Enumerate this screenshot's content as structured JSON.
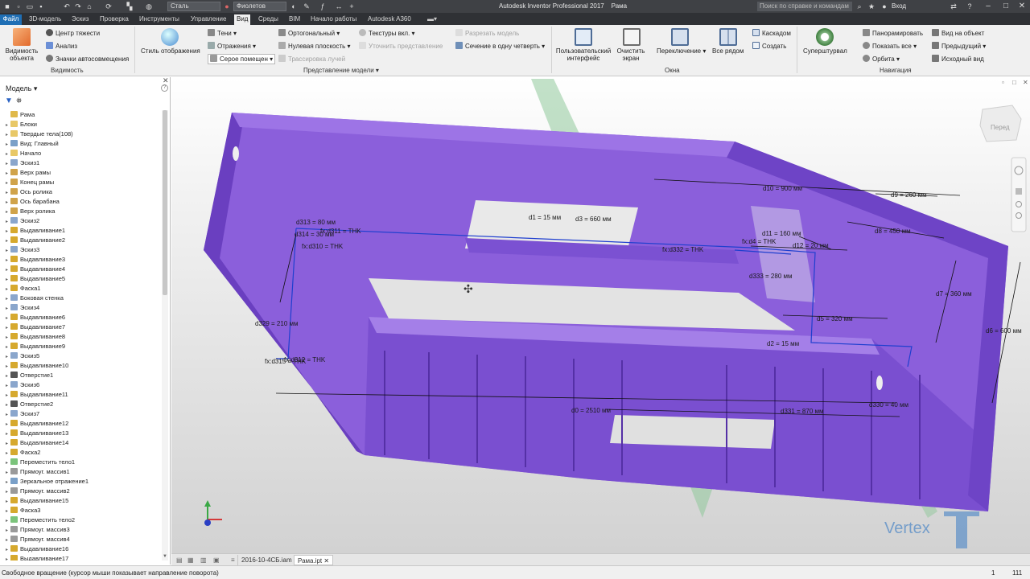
{
  "titlebar": {
    "material": "Сталь",
    "appearance": "Фиолетов",
    "app_title": "Autodesk Inventor Professional 2017",
    "document": "Рама",
    "help_search": "Поиск по справке и командам",
    "sign_in": "Вход"
  },
  "tabs": [
    "Файл",
    "3D-модель",
    "Эскиз",
    "Проверка",
    "Инструменты",
    "Управление",
    "Вид",
    "Среды",
    "BIM",
    "Начало работы",
    "Autodesk A360"
  ],
  "ribbon": {
    "visibility": {
      "object_visibility": "Видимость объекта",
      "center_gravity": "Центр тяжести",
      "analysis": "Анализ",
      "auto_offset_icons": "Значки автосовмещения",
      "label": "Видимость"
    },
    "appearance": {
      "display_style": "Стиль отображения",
      "shadows": "Тени",
      "reflections": "Отражения",
      "gray_room": "Серое помещен",
      "orthographic": "Ортогональный",
      "ground_plane": "Нулевая плоскость",
      "ray_tracing": "Трассировка лучей",
      "textures_on": "Текстуры вкл.",
      "refine_view": "Уточнить представление",
      "split_model": "Разрезать модель",
      "quarter_section": "Сечение в одну четверть",
      "label": "Представление модели"
    },
    "windows": {
      "user_interface": "Пользовательский интерфейс",
      "clean_screen": "Очистить экран",
      "switch": "Переключение",
      "tile": "Все рядом",
      "cascade": "Каскадом",
      "new": "Создать",
      "label": "Окна"
    },
    "navigation": {
      "steeringwheel": "Суперштурвал",
      "pan": "Панорамировать",
      "zoom_all": "Показать все",
      "orbit": "Орбита",
      "look_at": "Вид на объект",
      "previous": "Предыдущий",
      "home": "Исходный вид",
      "label": "Навигация"
    }
  },
  "browser": {
    "title": "Модель",
    "items": [
      {
        "label": "Рама",
        "icon": "part-icon"
      },
      {
        "label": "Блоки",
        "icon": "folder-icon"
      },
      {
        "label": "Твердые тела(108)",
        "icon": "folder-icon"
      },
      {
        "label": "Вид: Главный",
        "icon": "view-icon"
      },
      {
        "label": "Начало",
        "icon": "folder-icon"
      },
      {
        "label": "Эскиз1",
        "icon": "sketch-icon"
      },
      {
        "label": "Верх рамы",
        "icon": "plane-icon"
      },
      {
        "label": "Конец рамы",
        "icon": "plane-icon"
      },
      {
        "label": "Ось ролика",
        "icon": "plane-icon"
      },
      {
        "label": "Ось барабана",
        "icon": "plane-icon"
      },
      {
        "label": "Верх ролика",
        "icon": "plane-icon"
      },
      {
        "label": "Эскиз2",
        "icon": "sketch-icon"
      },
      {
        "label": "Выдавливание1",
        "icon": "extrude-icon"
      },
      {
        "label": "Выдавливание2",
        "icon": "extrude-icon"
      },
      {
        "label": "Эскиз3",
        "icon": "sketch-icon"
      },
      {
        "label": "Выдавливание3",
        "icon": "extrude-icon"
      },
      {
        "label": "Выдавливание4",
        "icon": "extrude-icon"
      },
      {
        "label": "Выдавливание5",
        "icon": "extrude-icon"
      },
      {
        "label": "Фаска1",
        "icon": "chamfer-icon"
      },
      {
        "label": "Боковая стенка",
        "icon": "sketch-icon"
      },
      {
        "label": "Эскиз4",
        "icon": "sketch-icon"
      },
      {
        "label": "Выдавливание6",
        "icon": "extrude-icon"
      },
      {
        "label": "Выдавливание7",
        "icon": "extrude-icon"
      },
      {
        "label": "Выдавливание8",
        "icon": "extrude-icon"
      },
      {
        "label": "Выдавливание9",
        "icon": "extrude-icon"
      },
      {
        "label": "Эскиз5",
        "icon": "sketch-icon"
      },
      {
        "label": "Выдавливание10",
        "icon": "extrude-icon"
      },
      {
        "label": "Отверстие1",
        "icon": "hole-icon"
      },
      {
        "label": "Эскиз6",
        "icon": "sketch-icon"
      },
      {
        "label": "Выдавливание11",
        "icon": "extrude-icon"
      },
      {
        "label": "Отверстие2",
        "icon": "hole-icon"
      },
      {
        "label": "Эскиз7",
        "icon": "sketch-icon"
      },
      {
        "label": "Выдавливание12",
        "icon": "extrude-icon"
      },
      {
        "label": "Выдавливание13",
        "icon": "extrude-icon"
      },
      {
        "label": "Выдавливание14",
        "icon": "extrude-icon"
      },
      {
        "label": "Фаска2",
        "icon": "chamfer-icon"
      },
      {
        "label": "Переместить тело1",
        "icon": "move-icon"
      },
      {
        "label": "Прямоуг. массив1",
        "icon": "pattern-icon"
      },
      {
        "label": "Зеркальное отражение1",
        "icon": "mirror-icon"
      },
      {
        "label": "Прямоуг. массив2",
        "icon": "pattern-icon"
      },
      {
        "label": "Выдавливание15",
        "icon": "extrude-icon"
      },
      {
        "label": "Фаска3",
        "icon": "chamfer-icon"
      },
      {
        "label": "Переместить тело2",
        "icon": "move-icon"
      },
      {
        "label": "Прямоуг. массив3",
        "icon": "pattern-icon"
      },
      {
        "label": "Прямоуг. массив4",
        "icon": "pattern-icon"
      },
      {
        "label": "Выдавливание16",
        "icon": "extrude-icon"
      },
      {
        "label": "Выдавливание17",
        "icon": "extrude-icon"
      }
    ]
  },
  "viewcube": {
    "face": "Перед"
  },
  "dimensions": [
    {
      "id": "d10",
      "text": "d10 = 900 мм"
    },
    {
      "id": "d9",
      "text": "d9 = 260 мм"
    },
    {
      "id": "d8",
      "text": "d8 = 450 мм"
    },
    {
      "id": "d11",
      "text": "d11 = 160 мм"
    },
    {
      "id": "d12",
      "text": "d12 = 20 мм"
    },
    {
      "id": "fxd4",
      "text": "fx:d4 = THK"
    },
    {
      "id": "d1",
      "text": "d1 = 15 мм"
    },
    {
      "id": "d3",
      "text": "d3 = 660 мм"
    },
    {
      "id": "d313",
      "text": "d313 = 80 мм"
    },
    {
      "id": "d311",
      "text": "fx:d311 = THK"
    },
    {
      "id": "d314",
      "text": "d314 = 30 мм"
    },
    {
      "id": "fxd310",
      "text": "fx:d310 = THK"
    },
    {
      "id": "fxd332",
      "text": "fx:d332 = THK"
    },
    {
      "id": "d333",
      "text": "d333 = 280 мм"
    },
    {
      "id": "d7",
      "text": "d7 = 360 мм"
    },
    {
      "id": "d5",
      "text": "d5 = 320 мм"
    },
    {
      "id": "d6",
      "text": "d6 = 600 мм"
    },
    {
      "id": "d2",
      "text": "d2 = 15 мм"
    },
    {
      "id": "d329",
      "text": "d329 = 210 мм"
    },
    {
      "id": "d312",
      "text": "fx:d312 = THK"
    },
    {
      "id": "d315",
      "text": "fx:d315 = THK"
    },
    {
      "id": "d0",
      "text": "d0 = 2510 мм"
    },
    {
      "id": "d331",
      "text": "d331 = 870 мм"
    },
    {
      "id": "d330",
      "text": "d330 = 40 мм"
    }
  ],
  "doc_tabs": [
    "2016-10-4СБ.iam",
    "Рама.ipt"
  ],
  "status": {
    "text": "Свободное вращение (курсор мыши показывает направление поворота)",
    "count1": "1",
    "count2": "111"
  },
  "watermark": "Vertex",
  "colors": {
    "model": "#8a5cd8",
    "model_dark": "#5a34a8",
    "plane": "#8fc89a",
    "file_tab": "#1f6fb5"
  }
}
